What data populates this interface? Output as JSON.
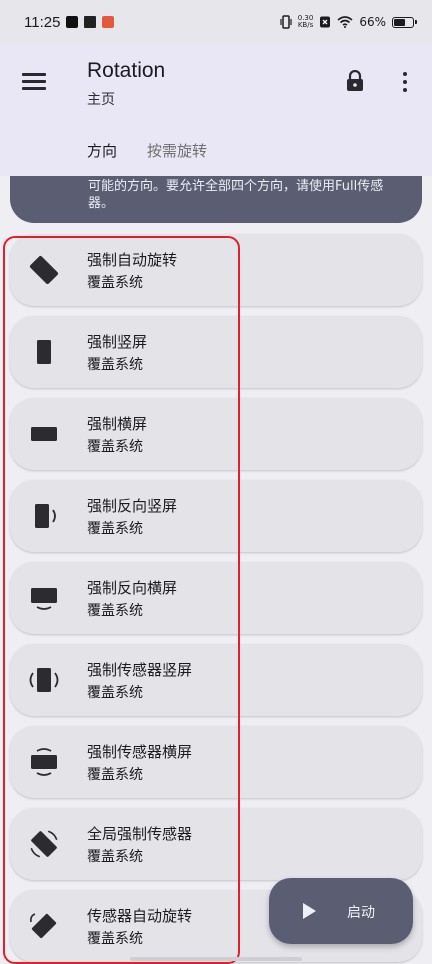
{
  "status_bar": {
    "time": "11:25",
    "speed_value": "0.30",
    "speed_unit": "KB/s",
    "battery_percent": "66%",
    "battery_level": 0.66
  },
  "app_bar": {
    "title": "Rotation",
    "subtitle": "主页"
  },
  "tabs": [
    {
      "label": "方向",
      "active": true
    },
    {
      "label": "按需旋转",
      "active": false
    }
  ],
  "note_card": {
    "text": "可能的方向。要允许全部四个方向，请使用Full传感器。"
  },
  "items": [
    {
      "title": "强制自动旋转",
      "subtitle": "覆盖系统",
      "icon": "auto-rotate-icon"
    },
    {
      "title": "强制竖屏",
      "subtitle": "覆盖系统",
      "icon": "portrait-icon"
    },
    {
      "title": "强制横屏",
      "subtitle": "覆盖系统",
      "icon": "landscape-icon"
    },
    {
      "title": "强制反向竖屏",
      "subtitle": "覆盖系统",
      "icon": "reverse-portrait-icon"
    },
    {
      "title": "强制反向横屏",
      "subtitle": "覆盖系统",
      "icon": "reverse-landscape-icon"
    },
    {
      "title": "强制传感器竖屏",
      "subtitle": "覆盖系统",
      "icon": "sensor-portrait-icon"
    },
    {
      "title": "强制传感器横屏",
      "subtitle": "覆盖系统",
      "icon": "sensor-landscape-icon"
    },
    {
      "title": "全局强制传感器",
      "subtitle": "覆盖系统",
      "icon": "full-sensor-icon"
    },
    {
      "title": "传感器自动旋转",
      "subtitle": "覆盖系统",
      "icon": "sensor-auto-rotate-icon"
    }
  ],
  "fab": {
    "label": "启动",
    "icon": "play-icon"
  },
  "colors": {
    "app_bar": "#e9e7f6",
    "card": "#e4e3e8",
    "accent": "#5b5e72",
    "highlight": "#e0202c"
  }
}
